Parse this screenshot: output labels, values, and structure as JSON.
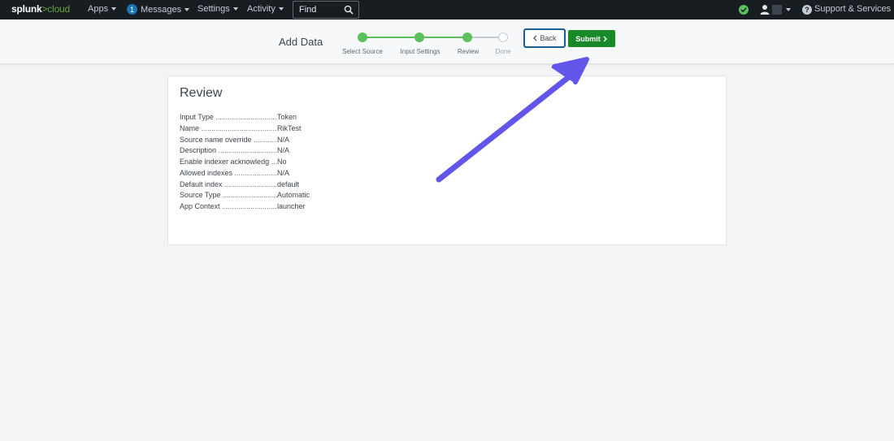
{
  "navbar": {
    "logo_main": "splunk",
    "logo_sep": ">",
    "logo_suffix": "cloud",
    "apps": "Apps",
    "messages_count": "1",
    "messages": "Messages",
    "settings": "Settings",
    "activity": "Activity",
    "find_placeholder": "Find",
    "support": "Support & Services"
  },
  "wizard": {
    "title": "Add Data",
    "steps": [
      {
        "label": "Select Source",
        "state": "complete"
      },
      {
        "label": "Input Settings",
        "state": "complete"
      },
      {
        "label": "Review",
        "state": "current"
      },
      {
        "label": "Done",
        "state": "pending"
      }
    ],
    "back_label": "Back",
    "submit_label": "Submit"
  },
  "review": {
    "title": "Review",
    "rows": [
      {
        "label": "Input Type",
        "value": "Token"
      },
      {
        "label": "Name",
        "value": "RikTest"
      },
      {
        "label": "Source name override",
        "value": "N/A"
      },
      {
        "label": "Description",
        "value": "N/A"
      },
      {
        "label": "Enable indexer acknowledg",
        "value": "No"
      },
      {
        "label": "Allowed indexes",
        "value": "N/A"
      },
      {
        "label": "Default index",
        "value": "default"
      },
      {
        "label": "Source Type",
        "value": "Automatic"
      },
      {
        "label": "App Context",
        "value": "launcher"
      }
    ]
  },
  "colors": {
    "navbar_bg": "#171d21",
    "accent_green": "#65a637",
    "step_green": "#5cc05c",
    "submit_green": "#1a8929",
    "focus_blue": "#1a5f97",
    "annotation_arrow": "#6155ea"
  },
  "icons": {
    "find": "search-icon",
    "status": "health-ok-icon",
    "user": "user-icon",
    "help": "help-icon",
    "back": "chevron-left-icon",
    "submit": "chevron-right-icon"
  }
}
